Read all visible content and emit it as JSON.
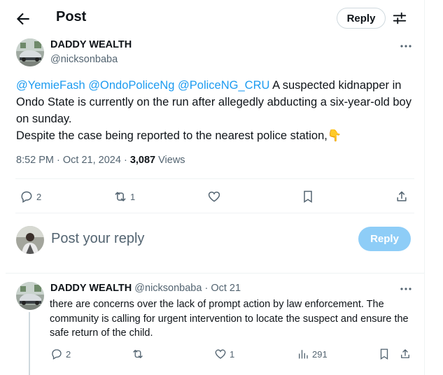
{
  "header": {
    "title": "Post",
    "reply_label": "Reply"
  },
  "post": {
    "display_name": "DADDY WEALTH",
    "handle": "@nicksonbaba",
    "mentions": [
      "@YemieFash",
      "@OndoPoliceNg",
      "@PoliceNG_CRU"
    ],
    "text_main": " A suspected kidnapper in Ondo State is currently on the run after allegedly abducting a six-year-old boy on sunday.",
    "text_second": "Despite the case being reported to the nearest police station,",
    "emoji": "👇",
    "time": "8:52 PM",
    "date": "Oct 21, 2024",
    "views_count": "3,087",
    "views_label": "Views",
    "replies": "2",
    "reposts": "1"
  },
  "compose": {
    "placeholder": "Post your reply",
    "button_label": "Reply"
  },
  "reply": {
    "display_name": "DADDY WEALTH",
    "handle": "@nicksonbaba",
    "sep": "·",
    "date": "Oct 21",
    "text": "there are concerns over the lack of prompt action by law enforcement. The community is calling for urgent intervention to locate the suspect and ensure the safe return of the child.",
    "replies": "2",
    "likes": "1",
    "views": "291"
  },
  "colors": {
    "accent": "#1d9bf0",
    "reply_button_disabled": "#8ecdf7",
    "secondary_text": "#536471",
    "divider": "#eff3f4"
  }
}
